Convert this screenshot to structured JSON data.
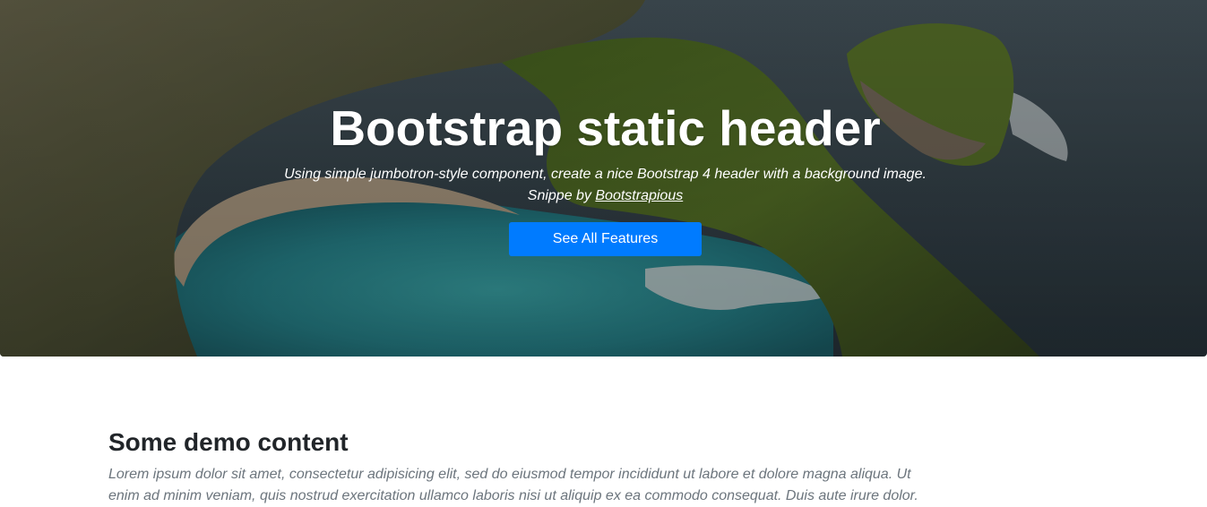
{
  "hero": {
    "title": "Bootstrap static header",
    "lead_text": "Using simple jumbotron-style component, create a nice Bootstrap 4 header with a background image.",
    "credit_prefix": "Snippe by ",
    "credit_link": "Bootstrapious",
    "button_label": "See All Features"
  },
  "content": {
    "heading": "Some demo content",
    "paragraph": "Lorem ipsum dolor sit amet, consectetur adipisicing elit, sed do eiusmod tempor incididunt ut labore et dolore magna aliqua. Ut enim ad minim veniam, quis nostrud exercitation ullamco laboris nisi ut aliquip ex ea commodo consequat. Duis aute irure dolor."
  },
  "colors": {
    "button": "#007bff",
    "heading": "#212529",
    "muted_text": "#6c757d"
  }
}
